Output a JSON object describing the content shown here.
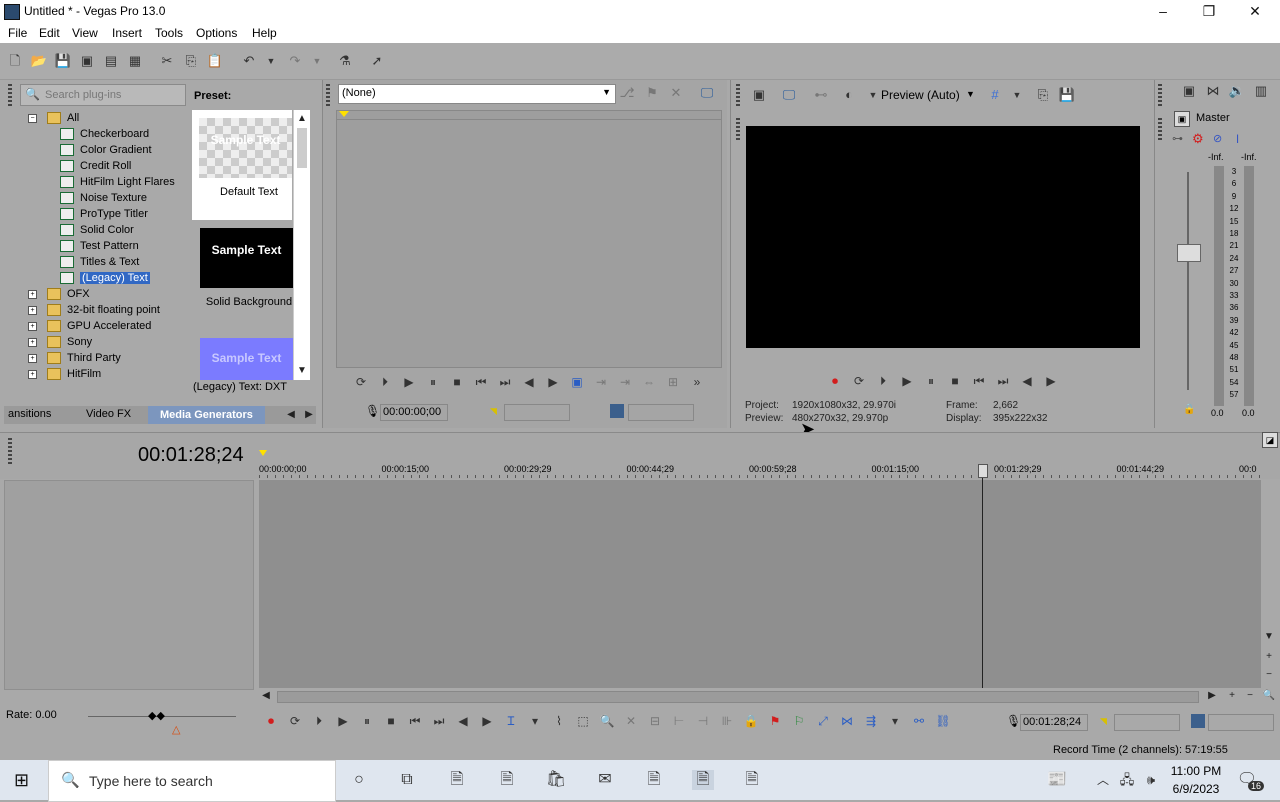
{
  "window": {
    "title": "Untitled * - Vegas Pro 13.0",
    "minimize_icon": "–",
    "maximize_icon": "❐",
    "close_icon": "✕"
  },
  "menu": [
    "File",
    "Edit",
    "View",
    "Insert",
    "Tools",
    "Options",
    "Help"
  ],
  "explorer": {
    "search_placeholder": "Search plug-ins",
    "preset_header": "Preset:",
    "tree": [
      {
        "label": "All",
        "level": 0,
        "type": "folder",
        "expanded": true
      },
      {
        "label": "Checkerboard",
        "level": 1,
        "type": "fx"
      },
      {
        "label": "Color Gradient",
        "level": 1,
        "type": "fx"
      },
      {
        "label": "Credit Roll",
        "level": 1,
        "type": "fx"
      },
      {
        "label": "HitFilm Light Flares",
        "level": 1,
        "type": "fx"
      },
      {
        "label": "Noise Texture",
        "level": 1,
        "type": "fx"
      },
      {
        "label": "ProType Titler",
        "level": 1,
        "type": "fx"
      },
      {
        "label": "Solid Color",
        "level": 1,
        "type": "fx"
      },
      {
        "label": "Test Pattern",
        "level": 1,
        "type": "fx"
      },
      {
        "label": "Titles & Text",
        "level": 1,
        "type": "fx"
      },
      {
        "label": "(Legacy) Text",
        "level": 1,
        "type": "fx",
        "selected": true
      },
      {
        "label": "OFX",
        "level": 0,
        "type": "folder"
      },
      {
        "label": "32-bit floating point",
        "level": 0,
        "type": "folder"
      },
      {
        "label": "GPU Accelerated",
        "level": 0,
        "type": "folder"
      },
      {
        "label": "Sony",
        "level": 0,
        "type": "folder"
      },
      {
        "label": "Third Party",
        "level": 0,
        "type": "folder"
      },
      {
        "label": "HitFilm",
        "level": 0,
        "type": "folder"
      }
    ],
    "presets": [
      {
        "thumb_text": "Sample Text",
        "label": "Default Text",
        "style": "checker"
      },
      {
        "thumb_text": "Sample Text",
        "label": "Solid Background",
        "style": "black"
      },
      {
        "thumb_text": "Sample Text",
        "label": "",
        "style": "blue"
      }
    ],
    "preset_status": "(Legacy) Text: DXT",
    "tabs": [
      "ansitions",
      "Video FX",
      "Media Generators"
    ]
  },
  "trimmer": {
    "dropdown_value": "(None)",
    "timecode": "00:00:00;00"
  },
  "preview": {
    "mode": "Preview (Auto)",
    "project_label": "Project:",
    "project_value": "1920x1080x32, 29.970i",
    "preview_label": "Preview:",
    "preview_value": "480x270x32, 29.970p",
    "frame_label": "Frame:",
    "frame_value": "2,662",
    "display_label": "Display:",
    "display_value": "395x222x32"
  },
  "master": {
    "title": "Master",
    "left_peak": "-Inf.",
    "right_peak": "-Inf.",
    "scale": [
      "3",
      "6",
      "9",
      "12",
      "15",
      "18",
      "21",
      "24",
      "27",
      "30",
      "33",
      "36",
      "39",
      "42",
      "45",
      "48",
      "51",
      "54",
      "57"
    ],
    "left_level": "0.0",
    "right_level": "0.0"
  },
  "timeline": {
    "current_time": "00:01:28;24",
    "ruler": [
      "00:00:00;00",
      "00:00:15;00",
      "00:00:29;29",
      "00:00:44;29",
      "00:00:59;28",
      "00:01:15;00",
      "00:01:29;29",
      "00:01:44;29",
      "00:0"
    ],
    "rate": "Rate: 0.00",
    "bottom_timecode": "00:01:28;24",
    "record_time": "Record Time (2 channels): 57:19:55"
  },
  "taskbar": {
    "search_placeholder": "Type here to search",
    "time": "11:00 PM",
    "date": "6/9/2023",
    "notification_count": "16"
  },
  "colors": {
    "selection": "#3168c4",
    "panel": "#a9a9a9",
    "video_bg": "#000000"
  }
}
